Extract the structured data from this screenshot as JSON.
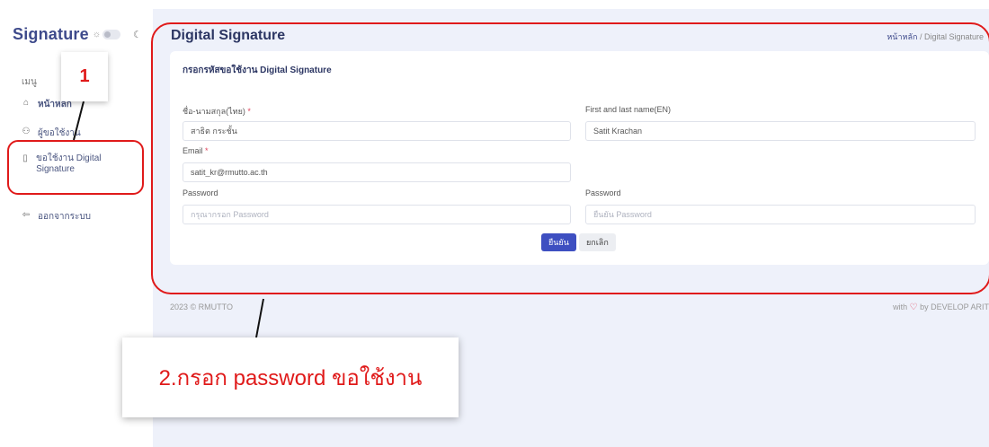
{
  "sidebar": {
    "brand": "Signature",
    "menu_title": "เมนู",
    "items": [
      {
        "label": "หน้าหลัก",
        "icon": "home-icon"
      },
      {
        "label": "ผู้ขอใช้งาน",
        "icon": "users-icon"
      },
      {
        "label": "ขอใช้งาน Digital Signature",
        "icon": "document-icon"
      },
      {
        "label": "ออกจากระบบ",
        "icon": "logout-icon"
      }
    ]
  },
  "header": {
    "title": "Digital Signature",
    "breadcrumb": [
      "หน้าหลัก",
      "Digital Signature"
    ]
  },
  "form": {
    "title": "กรอกรหัสขอใช้งาน Digital Signature",
    "fields": {
      "name_th": {
        "label": "ชื่อ-นามสกุล(ไทย)",
        "value": "สาธิต กระชั้น"
      },
      "name_en": {
        "label": "First and last name(EN)",
        "value": "Satit Krachan"
      },
      "email": {
        "label": "Email",
        "value": "satit_kr@rmutto.ac.th"
      },
      "password": {
        "label": "Password",
        "placeholder": "กรุณากรอก Password",
        "value": ""
      },
      "password_confirm": {
        "label": "Password",
        "placeholder": "ยืนยัน Password",
        "value": ""
      }
    },
    "confirm_label": "ยืนยัน",
    "cancel_label": "ยกเลิก"
  },
  "footer": {
    "copyright": "2023 © RMUTTO",
    "credit_prefix": "with",
    "credit_suffix": "by DEVELOP ARIT"
  },
  "annotations": {
    "step1": "1",
    "step2": "2.กรอก password ขอใช้งาน",
    "color": "#e01a1a"
  },
  "colors": {
    "brand": "#3e4a8b",
    "primary_button": "#3e4fc1",
    "required_star": "#e0455d",
    "background": "#eef1fa"
  }
}
